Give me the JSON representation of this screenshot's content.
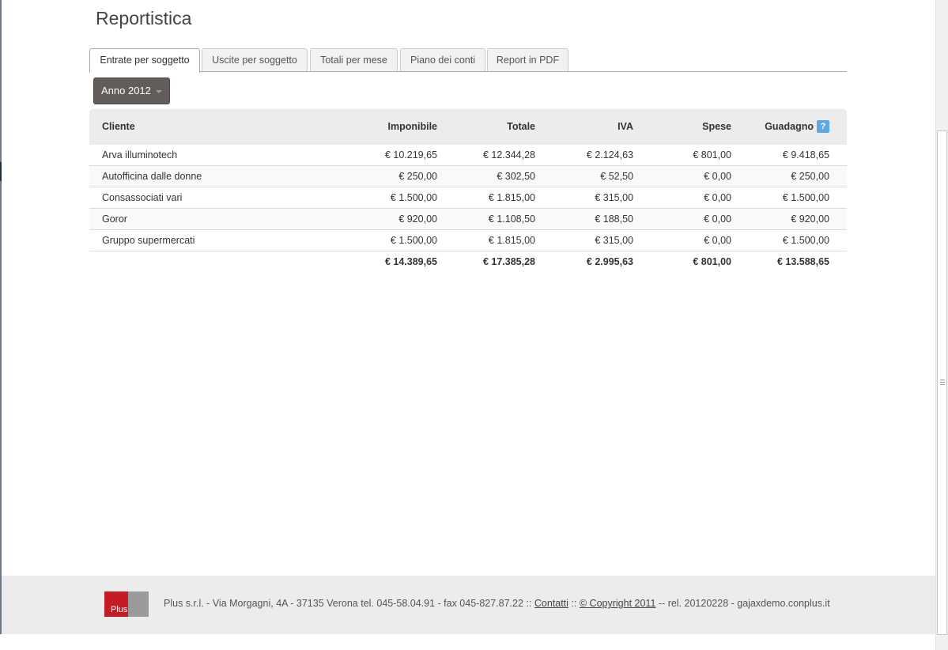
{
  "page": {
    "title": "Reportistica"
  },
  "tabs": [
    {
      "label": "Entrate per soggetto",
      "active": true
    },
    {
      "label": "Uscite per soggetto"
    },
    {
      "label": "Totali per mese"
    },
    {
      "label": "Piano dei conti"
    },
    {
      "label": "Report in PDF"
    }
  ],
  "year_filter": {
    "label": "Anno 2012"
  },
  "table": {
    "headers": [
      "Cliente",
      "Imponibile",
      "Totale",
      "IVA",
      "Spese",
      "Guadagno"
    ],
    "help_icon": "?",
    "rows": [
      [
        "Arva illuminotech",
        "€ 10.219,65",
        "€ 12.344,28",
        "€ 2.124,63",
        "€ 801,00",
        "€ 9.418,65"
      ],
      [
        "Autofficina dalle donne",
        "€ 250,00",
        "€ 302,50",
        "€ 52,50",
        "€ 0,00",
        "€ 250,00"
      ],
      [
        "Consassociati vari",
        "€ 1.500,00",
        "€ 1.815,00",
        "€ 315,00",
        "€ 0,00",
        "€ 1.500,00"
      ],
      [
        "Goror",
        "€ 920,00",
        "€ 1.108,50",
        "€ 188,50",
        "€ 0,00",
        "€ 920,00"
      ],
      [
        "Gruppo supermercati",
        "€ 1.500,00",
        "€ 1.815,00",
        "€ 315,00",
        "€ 0,00",
        "€ 1.500,00"
      ]
    ],
    "totals": [
      "",
      "€ 14.389,65",
      "€ 17.385,28",
      "€ 2.995,63",
      "€ 801,00",
      "€ 13.588,65"
    ]
  },
  "footer": {
    "logo_text": "Plus",
    "address": "Plus s.r.l. - Via Morgagni, 4A - 37135 Verona tel. 045-58.04.91 - fax 045-827.87.22 ::",
    "contacts_link": "Contatti",
    "separator": "::",
    "copyright_link": "© Copyright 2011",
    "release": "-- rel. 20120228 - gajaxdemo.conplus.it"
  },
  "colors": {
    "accent_red": "#c41b24",
    "button_dark": "#625d5a",
    "help_blue": "#5aa8e6"
  }
}
